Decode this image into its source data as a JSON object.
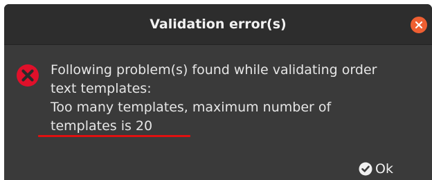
{
  "dialog": {
    "title": "Validation error(s)",
    "close_icon": "close-icon",
    "error_icon": "error-icon",
    "message_lines": [
      "Following problem(s) found while validating order",
      "text templates:",
      "Too many templates, maximum number of",
      "templates is 20"
    ],
    "ok_label": "Ok",
    "ok_icon": "check-circle-icon"
  },
  "colors": {
    "dialog_bg": "#3a3a3a",
    "titlebar_bg": "#2d2d2d",
    "close_button": "#ef5f32",
    "error_icon": "#e0102a",
    "annotation_underline": "#e01010",
    "text": "#e6e6e6"
  }
}
